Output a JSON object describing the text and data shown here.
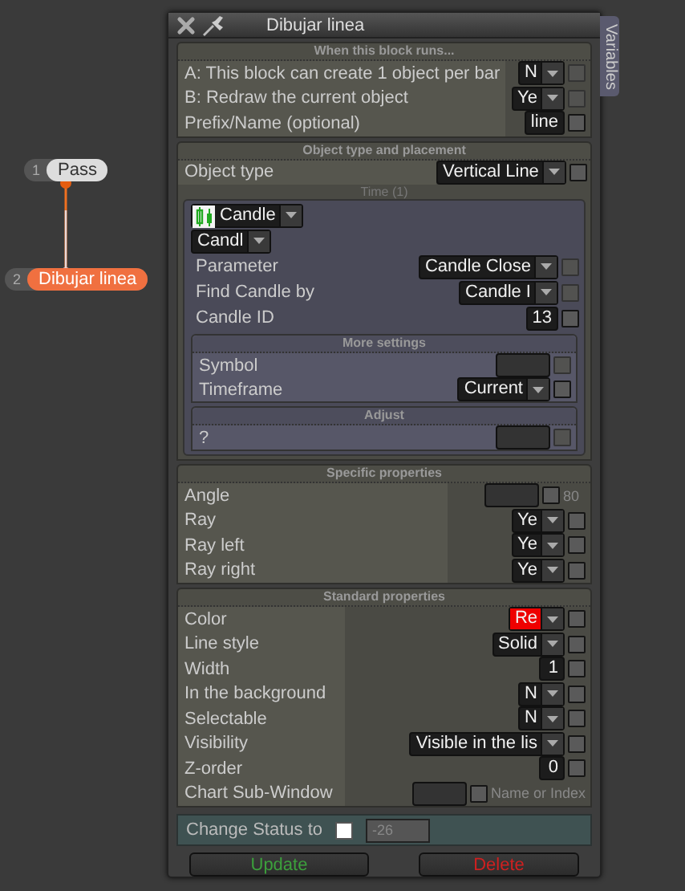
{
  "window": {
    "title": "Dibujar linea",
    "side_tab": "Variables"
  },
  "nodes": [
    {
      "number": "1",
      "label": "Pass",
      "selected": false
    },
    {
      "number": "2",
      "label": "Dibujar linea",
      "selected": true
    }
  ],
  "sections": [
    {
      "title": "When this block runs...",
      "rows": [
        {
          "kind": "select",
          "label": "A: This block can create 1 object per bar",
          "value": "N",
          "checked": false,
          "disabled": true
        },
        {
          "kind": "select",
          "label": "B: Redraw the current object",
          "value": "Ye",
          "checked": false,
          "disabled": true
        },
        {
          "kind": "input",
          "label": "Prefix/Name (optional)",
          "value": "line",
          "checked": false,
          "disabled": false
        }
      ]
    },
    {
      "title": "Object type and placement",
      "rows": [
        {
          "kind": "select",
          "label": "Object type",
          "value": "Vertical Line",
          "checked": false,
          "disabled": false
        }
      ],
      "group": {
        "caption": "Time (1)",
        "rows": [
          {
            "kind": "icon-select",
            "value": "Candle"
          },
          {
            "kind": "lead-select",
            "value": "Candl"
          },
          {
            "kind": "select",
            "label": "Parameter",
            "value": "Candle Close",
            "checked": false,
            "disabled": true
          },
          {
            "kind": "select",
            "label": "Find Candle by",
            "value": "Candle I",
            "checked": false,
            "disabled": true
          },
          {
            "kind": "input",
            "label": "Candle ID",
            "value": "13",
            "checked": false,
            "disabled": false
          }
        ],
        "subgroups": [
          {
            "title": "More settings",
            "rows": [
              {
                "kind": "empty",
                "label": "Symbol",
                "checked": false,
                "disabled": true
              },
              {
                "kind": "select",
                "label": "Timeframe",
                "value": "Current",
                "checked": false,
                "disabled": false
              }
            ]
          },
          {
            "title": "Adjust",
            "rows": [
              {
                "kind": "empty",
                "label": "?",
                "checked": false,
                "disabled": true
              }
            ]
          }
        ]
      }
    },
    {
      "title": "Specific properties",
      "rows": [
        {
          "kind": "empty",
          "label": "Angle",
          "checked": false,
          "disabled": false,
          "note": "80"
        },
        {
          "kind": "select",
          "label": "Ray",
          "value": "Ye",
          "checked": false,
          "disabled": false
        },
        {
          "kind": "select",
          "label": "Ray left",
          "value": "Ye",
          "checked": false,
          "disabled": false
        },
        {
          "kind": "select",
          "label": "Ray right",
          "value": "Ye",
          "checked": false,
          "disabled": false
        }
      ]
    },
    {
      "title": "Standard properties",
      "rows": [
        {
          "kind": "select",
          "label": "Color",
          "value": "Re",
          "color": "#ee0000",
          "checked": false,
          "disabled": false
        },
        {
          "kind": "select",
          "label": "Line style",
          "value": "Solid",
          "checked": false,
          "disabled": false
        },
        {
          "kind": "input",
          "label": "Width",
          "value": "1",
          "checked": false,
          "disabled": false
        },
        {
          "kind": "select",
          "label": "In the background",
          "value": "N",
          "checked": false,
          "disabled": false
        },
        {
          "kind": "select",
          "label": "Selectable",
          "value": "N",
          "checked": false,
          "disabled": false
        },
        {
          "kind": "select",
          "label": "Visibility",
          "value": "Visible in the lis",
          "checked": false,
          "disabled": false
        },
        {
          "kind": "input",
          "label": "Z-order",
          "value": "0",
          "checked": false,
          "disabled": false
        },
        {
          "kind": "empty",
          "label": "Chart Sub-Window",
          "checked": false,
          "disabled": false,
          "note": "Name or Index"
        }
      ]
    }
  ],
  "change_status": {
    "label": "Change Status to",
    "checked": false,
    "placeholder": "-26"
  },
  "buttons": [
    {
      "label": "Update",
      "kind": "confirm"
    },
    {
      "label": "Delete",
      "kind": "danger"
    }
  ]
}
